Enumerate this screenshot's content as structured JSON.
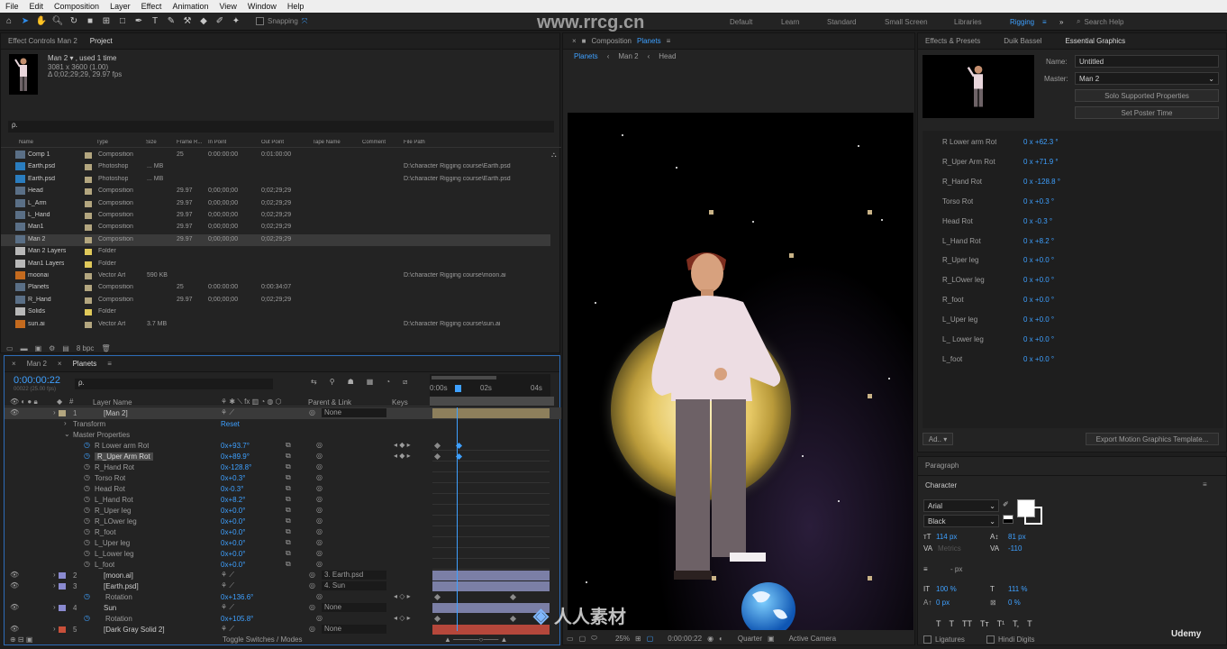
{
  "menu": [
    "File",
    "Edit",
    "Composition",
    "Layer",
    "Effect",
    "Animation",
    "View",
    "Window",
    "Help"
  ],
  "toolbar": {
    "snapping": "Snapping",
    "workspaces": [
      "Default",
      "Learn",
      "Standard",
      "Small Screen",
      "Libraries",
      "Rigging"
    ],
    "active_workspace": "Rigging",
    "search": "Search Help",
    "more": "»"
  },
  "project_panel": {
    "tabs": [
      "Effect Controls Man 2",
      "Project"
    ],
    "preview": {
      "name": "Man 2 ▾ , used 1 time",
      "size": "3081 x 3600 (1.00)",
      "duration": "Δ 0;02;29;29, 29.97 fps"
    },
    "search_placeholder": "ρ.",
    "columns": [
      "Name",
      "Type",
      "Size",
      "Frame R...",
      "In Point",
      "Out Point",
      "Tape Name",
      "Comment",
      "File Path"
    ],
    "rows": [
      {
        "name": "Comp 1",
        "type": "Composition",
        "size": "",
        "fr": "25",
        "in": "0:00:00:00",
        "out": "0:01:00:00",
        "path": "",
        "color": "#b3a67f",
        "icon": "comp"
      },
      {
        "name": "Earth.psd",
        "type": "Photoshop",
        "size": "... MB",
        "fr": "",
        "in": "",
        "out": "",
        "path": "D:\\character Rigging course\\Earth.psd",
        "color": "#b3a67f",
        "icon": "psd"
      },
      {
        "name": "Earth.psd",
        "type": "Photoshop",
        "size": "... MB",
        "fr": "",
        "in": "",
        "out": "",
        "path": "D:\\character Rigging course\\Earth.psd",
        "color": "#b3a67f",
        "icon": "psd"
      },
      {
        "name": "Head",
        "type": "Composition",
        "size": "",
        "fr": "29.97",
        "in": "0;00;00;00",
        "out": "0;02;29;29",
        "path": "",
        "color": "#b3a67f",
        "icon": "comp"
      },
      {
        "name": "L_Arm",
        "type": "Composition",
        "size": "",
        "fr": "29.97",
        "in": "0;00;00;00",
        "out": "0;02;29;29",
        "path": "",
        "color": "#b3a67f",
        "icon": "comp"
      },
      {
        "name": "L_Hand",
        "type": "Composition",
        "size": "",
        "fr": "29.97",
        "in": "0;00;00;00",
        "out": "0;02;29;29",
        "path": "",
        "color": "#b3a67f",
        "icon": "comp"
      },
      {
        "name": "Man1",
        "type": "Composition",
        "size": "",
        "fr": "29.97",
        "in": "0;00;00;00",
        "out": "0;02;29;29",
        "path": "",
        "color": "#b3a67f",
        "icon": "comp"
      },
      {
        "name": "Man 2",
        "type": "Composition",
        "size": "",
        "fr": "29.97",
        "in": "0;00;00;00",
        "out": "0;02;29;29",
        "path": "",
        "color": "#b3a67f",
        "icon": "comp",
        "selected": true
      },
      {
        "name": "Man 2 Layers",
        "type": "Folder",
        "size": "",
        "fr": "",
        "in": "",
        "out": "",
        "path": "",
        "color": "#e0c95a",
        "icon": "folder"
      },
      {
        "name": "Man1 Layers",
        "type": "Folder",
        "size": "",
        "fr": "",
        "in": "",
        "out": "",
        "path": "",
        "color": "#e0c95a",
        "icon": "folder"
      },
      {
        "name": "moonai",
        "type": "Vector Art",
        "size": "590 KB",
        "fr": "",
        "in": "",
        "out": "",
        "path": "D:\\character Rigging course\\moon.ai",
        "color": "#b3a67f",
        "icon": "ai"
      },
      {
        "name": "Planets",
        "type": "Composition",
        "size": "",
        "fr": "25",
        "in": "0:00:00:00",
        "out": "0:00:34:07",
        "path": "",
        "color": "#b3a67f",
        "icon": "comp"
      },
      {
        "name": "R_Hand",
        "type": "Composition",
        "size": "",
        "fr": "29.97",
        "in": "0;00;00;00",
        "out": "0;02;29;29",
        "path": "",
        "color": "#b3a67f",
        "icon": "comp"
      },
      {
        "name": "Solids",
        "type": "Folder",
        "size": "",
        "fr": "",
        "in": "",
        "out": "",
        "path": "",
        "color": "#e0c95a",
        "icon": "folder"
      },
      {
        "name": "sun.ai",
        "type": "Vector Art",
        "size": "3.7 MB",
        "fr": "",
        "in": "",
        "out": "",
        "path": "D:\\character Rigging course\\sun.ai",
        "color": "#b3a67f",
        "icon": "ai"
      }
    ],
    "bpc": "8 bpc"
  },
  "timeline": {
    "tabs": [
      "Man 2",
      "Planets"
    ],
    "timecode": "0:00:00:22",
    "fps": "00022 (25.00 fps)",
    "search_placeholder": "ρ.",
    "headers": {
      "layer_name": "Layer Name",
      "parent": "Parent & Link",
      "keys": "Keys"
    },
    "ruler": [
      "0:00s",
      "02s",
      "04s"
    ],
    "layers": [
      {
        "num": "1",
        "name": "[Man 2]",
        "parent": "None",
        "color": "#b3a67f"
      }
    ],
    "transform": "Transform",
    "reset": "Reset",
    "master_properties": "Master Properties",
    "props": [
      {
        "name": "R Lower arm Rot",
        "value": "0x+93.7°",
        "kf": true
      },
      {
        "name": "R_Uper Arm Rot",
        "value": "0x+89.9°",
        "kf": true,
        "selected": true
      },
      {
        "name": "R_Hand Rot",
        "value": "0x-128.8°"
      },
      {
        "name": "Torso Rot",
        "value": "0x+0.3°"
      },
      {
        "name": "Head Rot",
        "value": "0x-0.3°"
      },
      {
        "name": "L_Hand Rot",
        "value": "0x+8.2°"
      },
      {
        "name": "R_Uper leg",
        "value": "0x+0.0°"
      },
      {
        "name": "R_LOwer leg",
        "value": "0x+0.0°"
      },
      {
        "name": "R_foot",
        "value": "0x+0.0°"
      },
      {
        "name": "L_Uper leg",
        "value": "0x+0.0°"
      },
      {
        "name": "L_Lower leg",
        "value": "0x+0.0°"
      },
      {
        "name": "L_foot",
        "value": "0x+0.0°"
      }
    ],
    "more_layers": [
      {
        "num": "2",
        "name": "[moon.ai]",
        "parent": "3. Earth.psd",
        "color": "#8a8ad0"
      },
      {
        "num": "3",
        "name": "[Earth.psd]",
        "parent": "4. Sun",
        "color": "#8a8ad0"
      },
      {
        "rot": true,
        "name": "Rotation",
        "value": "0x+136.6°"
      },
      {
        "num": "4",
        "name": "Sun",
        "parent": "None",
        "color": "#8a8ad0"
      },
      {
        "rot": true,
        "name": "Rotation",
        "value": "0x+105.8°"
      },
      {
        "num": "5",
        "name": "[Dark Gray Solid 2]",
        "parent": "None",
        "color": "#c9503a"
      }
    ],
    "toggle": "Toggle Switches / Modes"
  },
  "composition": {
    "title": "Composition",
    "comp_name": "Planets",
    "breadcrumbs": [
      "Planets",
      "Man 2",
      "Head"
    ],
    "footer": {
      "zoom": "25%",
      "time": "0:00:00:22",
      "quality": "Quarter",
      "camera": "Active Camera"
    }
  },
  "essential_graphics": {
    "tabs": [
      "Effects & Presets",
      "Duik Bassel",
      "Essential Graphics"
    ],
    "name_label": "Name:",
    "name_value": "Untitled",
    "master_label": "Master:",
    "master_value": "Man 2",
    "solo_btn": "Solo Supported Properties",
    "poster_btn": "Set Poster Time",
    "props": [
      {
        "name": "R Lower arm Rot",
        "value": "0 x +62.3 °"
      },
      {
        "name": "R_Uper Arm Rot",
        "value": "0 x +71.9 °"
      },
      {
        "name": "R_Hand Rot",
        "value": "0 x -128.8 °"
      },
      {
        "name": "Torso Rot",
        "value": "0 x +0.3 °"
      },
      {
        "name": "Head Rot",
        "value": "0 x -0.3 °"
      },
      {
        "name": "L_Hand Rot",
        "value": "0 x +8.2 °"
      },
      {
        "name": "R_Uper leg",
        "value": "0 x +0.0 °"
      },
      {
        "name": "R_LOwer leg",
        "value": "0 x +0.0 °"
      },
      {
        "name": "R_foot",
        "value": "0 x +0.0 °"
      },
      {
        "name": "L_Uper leg",
        "value": "0 x +0.0 °"
      },
      {
        "name": "L_ Lower leg",
        "value": "0 x +0.0 °"
      },
      {
        "name": "L_foot",
        "value": "0 x +0.0 °"
      }
    ],
    "add_btn": "Ad.. ▾",
    "export_btn": "Export Motion Graphics Template..."
  },
  "paragraph": {
    "title": "Paragraph"
  },
  "character": {
    "title": "Character",
    "font": "Arial",
    "style": "Black",
    "size": "114 px",
    "leading": "81 px",
    "tracking": "-110",
    "kerning": "Metrics",
    "indent": "- px",
    "vscale": "100 %",
    "hscale": "111 %",
    "baseline": "0 px",
    "tsume": "0 %",
    "ligatures": "Ligatures",
    "hindi": "Hindi Digits",
    "styles": [
      "T",
      "T",
      "TT",
      "Tт",
      "T¹",
      "T,",
      "T"
    ]
  },
  "watermark": {
    "site": "www.rrcg.cn",
    "brand": "人人素材",
    "udemy": "Udemy"
  },
  "colors": {
    "accent": "#3ea0ff",
    "panel": "#232323",
    "bg": "#1d1d1d"
  }
}
